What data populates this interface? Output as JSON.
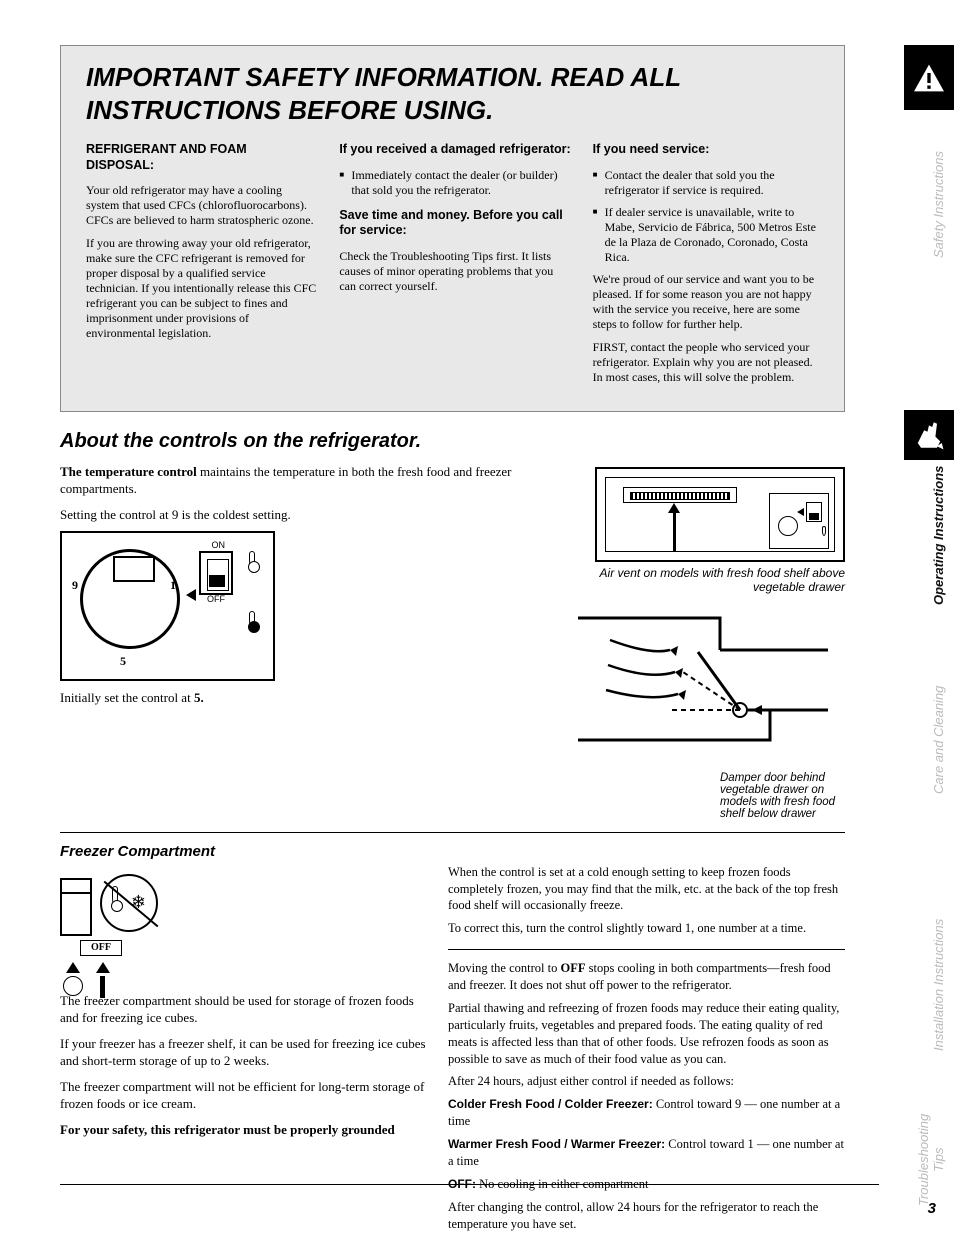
{
  "sidebar": {
    "safety": "Safety Instructions",
    "operating": "Operating Instructions",
    "care": "Care and Cleaning",
    "install": "Installation Instructions",
    "trouble": "Troubleshooting Tips"
  },
  "warning": {
    "heading": "IMPORTANT SAFETY INFORMATION. READ ALL INSTRUCTIONS BEFORE USING.",
    "cfc_title": "REFRIGERANT AND FOAM DISPOSAL:",
    "cfc_body": "Your old refrigerator may have a cooling system that used CFCs (chlorofluorocarbons). CFCs are believed to harm stratospheric ozone.",
    "cfc_body2": "If you are throwing away your old refrigerator, make sure the CFC refrigerant is removed for proper disposal by a qualified service technician. If you intentionally release this CFC refrigerant you can be subject to fines and imprisonment under provisions of environmental legislation.",
    "col2_lead": "If you received a damaged refrigerator:",
    "col2_item": "Immediately contact the dealer (or builder) that sold you the refrigerator.",
    "col2_save": "Save time and money. Before you call for service:",
    "col2_save_body": "Check the Troubleshooting Tips first. It lists causes of minor operating problems that you can correct yourself.",
    "col3_lead": "If you need service:",
    "col3_items": [
      "Contact the dealer that sold you the refrigerator if service is required.",
      "If dealer service is unavailable, write to Mabe, Servicio de Fábrica, 500 Metros Este de la Plaza de Coronado, Coronado, Costa Rica."
    ],
    "col3_note": "We're proud of our service and want you to be pleased. If for some reason you are not happy with the service you receive, here are some steps to follow for further help.",
    "col3_note2": "FIRST, contact the people who serviced your refrigerator. Explain why you are not pleased. In most cases, this will solve the problem."
  },
  "controls": {
    "title": "About the controls on the refrigerator.",
    "dial_nums": {
      "n9": "9",
      "n5": "5",
      "n1": "1",
      "on": "ON",
      "off": "OFF"
    },
    "left_p1_a": "The temperature control ",
    "left_p1_b": "maintains the temperature in both the fresh food and freezer compartments.",
    "left_p2": "Setting the control at 9 is the coldest setting.",
    "left_p3_a": "Initially set the control at ",
    "left_p3_b": "5.",
    "cap_top": "Air vent on models with fresh food shelf above vegetable drawer",
    "right_p1": "When the control is set at a cold enough setting to keep frozen foods completely frozen, you may find that the milk, etc. at the back of the top fresh food shelf will occasionally freeze.",
    "right_p2": "To correct this, turn the control slightly toward 1, one number at a time.",
    "right_p3_a": "Moving the control to ",
    "right_p3_b": "OFF",
    "right_p3_c": " stops cooling in both compartments—fresh food and freezer. It does not shut off power to the refrigerator.",
    "right_p4": "Partial thawing and refreezing of frozen foods may reduce their eating quality, particularly fruits, vegetables and prepared foods. The eating quality of red meats is affected less than that of other foods. Use refrozen foods as soon as possible to save as much of their food value as you can.",
    "damper_cap": "Damper door behind vegetable drawer on models with fresh food shelf below drawer"
  },
  "freezer": {
    "title": "Freezer Compartment",
    "off_label": "OFF",
    "p1": "The freezer compartment should be used for storage of frozen foods and for freezing ice cubes.",
    "p2": "If your freezer has a freezer shelf, it can be used for freezing ice cubes and short-term storage of up to 2 weeks.",
    "p3": "The freezer compartment will not be efficient for long-term storage of frozen foods or ice cream.",
    "p4": "For your safety, this refrigerator must be properly grounded",
    "list_intro": "After 24 hours, adjust either control if needed as follows:",
    "items": [
      {
        "label": "Colder Fresh Food / Colder Freezer:",
        "body": "Control toward 9 — one number at a time"
      },
      {
        "label": "Warmer Fresh Food / Warmer Freezer:",
        "body": "Control toward 1 — one number at a time"
      },
      {
        "label": "OFF:",
        "body": "No cooling in either compartment"
      }
    ],
    "p5": "After changing the control, allow 24 hours for the refrigerator to reach the temperature you have set."
  },
  "page_number": "3"
}
